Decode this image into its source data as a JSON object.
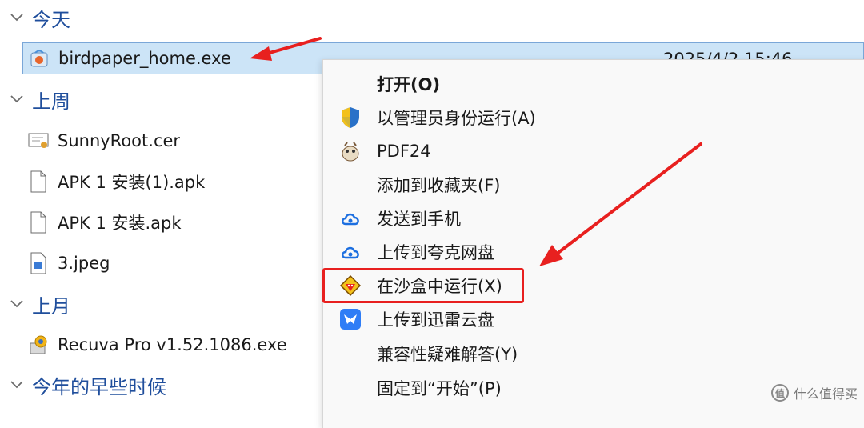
{
  "groups": {
    "today": "今天",
    "last_week": "上周",
    "last_month": "上月",
    "earlier_this_year": "今年的早些时候"
  },
  "files": {
    "selected": {
      "name": "birdpaper_home.exe",
      "date": "2025/4/2 15:46",
      "icon": "exe-app-icon"
    },
    "last_week": [
      {
        "name": "SunnyRoot.cer",
        "icon": "certificate-icon"
      },
      {
        "name": "APK 1 安装(1).apk",
        "icon": "file-icon"
      },
      {
        "name": "APK 1 安装.apk",
        "icon": "file-icon"
      },
      {
        "name": "3.jpeg",
        "icon": "image-file-icon"
      }
    ],
    "last_month": [
      {
        "name": "Recuva Pro v1.52.1086.exe",
        "icon": "installer-icon"
      }
    ]
  },
  "context_menu": {
    "items": [
      {
        "label": "打开(O)",
        "icon": "",
        "bold": true
      },
      {
        "label": "以管理员身份运行(A)",
        "icon": "uac-shield-icon"
      },
      {
        "label": "PDF24",
        "icon": "pdf24-icon"
      },
      {
        "label": "添加到收藏夹(F)",
        "icon": ""
      },
      {
        "label": "发送到手机",
        "icon": "quark-cloud-icon"
      },
      {
        "label": "上传到夸克网盘",
        "icon": "quark-cloud-icon"
      },
      {
        "label": "在沙盒中运行(X)",
        "icon": "sandboxie-icon",
        "highlighted": true
      },
      {
        "label": "上传到迅雷云盘",
        "icon": "thunder-bird-icon"
      },
      {
        "label": "兼容性疑难解答(Y)",
        "icon": ""
      },
      {
        "label": "固定到“开始”(P)",
        "icon": ""
      }
    ]
  },
  "watermark": {
    "logo": "值",
    "text": "什么值得买"
  },
  "colors": {
    "header": "#1f4e9c",
    "selection": "#cce4f7",
    "arrow": "#e8201f",
    "highlight": "#e8201f"
  }
}
